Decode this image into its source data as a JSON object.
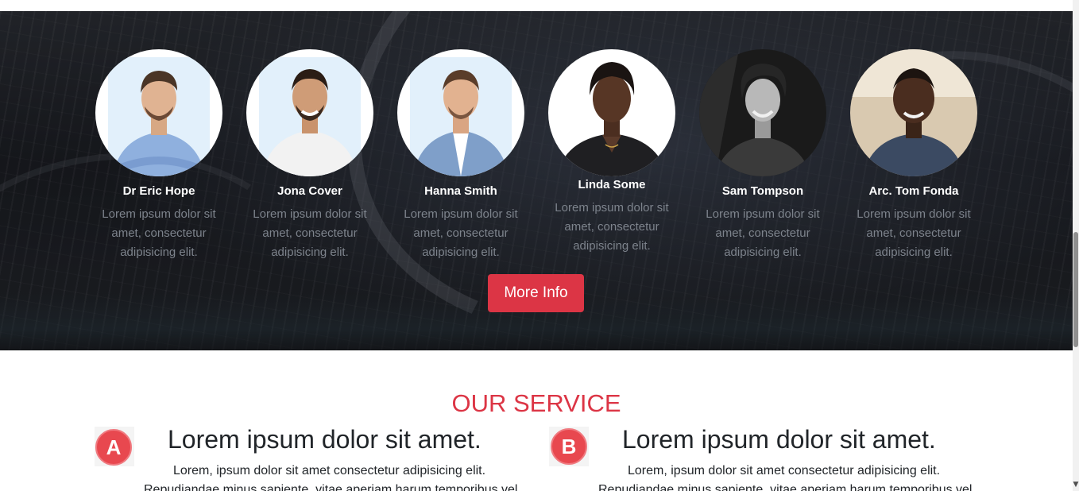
{
  "team": {
    "members": [
      {
        "name": "Dr Eric Hope",
        "text": "Lorem ipsum dolor sit amet, consectetur adipisicing elit."
      },
      {
        "name": "Jona Cover",
        "text": "Lorem ipsum dolor sit amet, consectetur adipisicing elit."
      },
      {
        "name": "Hanna Smith",
        "text": "Lorem ipsum dolor sit amet, consectetur adipisicing elit."
      },
      {
        "name": "Linda Some",
        "text": "Lorem ipsum dolor sit amet, consectetur adipisicing elit."
      },
      {
        "name": "Sam Tompson",
        "text": "Lorem ipsum dolor sit amet, consectetur adipisicing elit."
      },
      {
        "name": "Arc. Tom Fonda",
        "text": "Lorem ipsum dolor sit amet, consectetur adipisicing elit."
      }
    ],
    "more_button": "More Info"
  },
  "services": {
    "title": "OUR SERVICE",
    "items": [
      {
        "icon": "letter-a-icon",
        "letter": "A",
        "heading": "Lorem ipsum dolor sit amet.",
        "line1": "Lorem, ipsum dolor sit amet consectetur adipisicing elit.",
        "line2": "Repudiandae minus sapiente, vitae aperiam harum temporibus vel"
      },
      {
        "icon": "letter-b-icon",
        "letter": "B",
        "heading": "Lorem ipsum dolor sit amet.",
        "line1": "Lorem, ipsum dolor sit amet consectetur adipisicing elit.",
        "line2": "Repudiandae minus sapiente, vitae aperiam harum temporibus vel"
      }
    ]
  },
  "colors": {
    "accent": "#dc3545",
    "text_dark": "#212529",
    "text_muted": "#7d838c"
  }
}
